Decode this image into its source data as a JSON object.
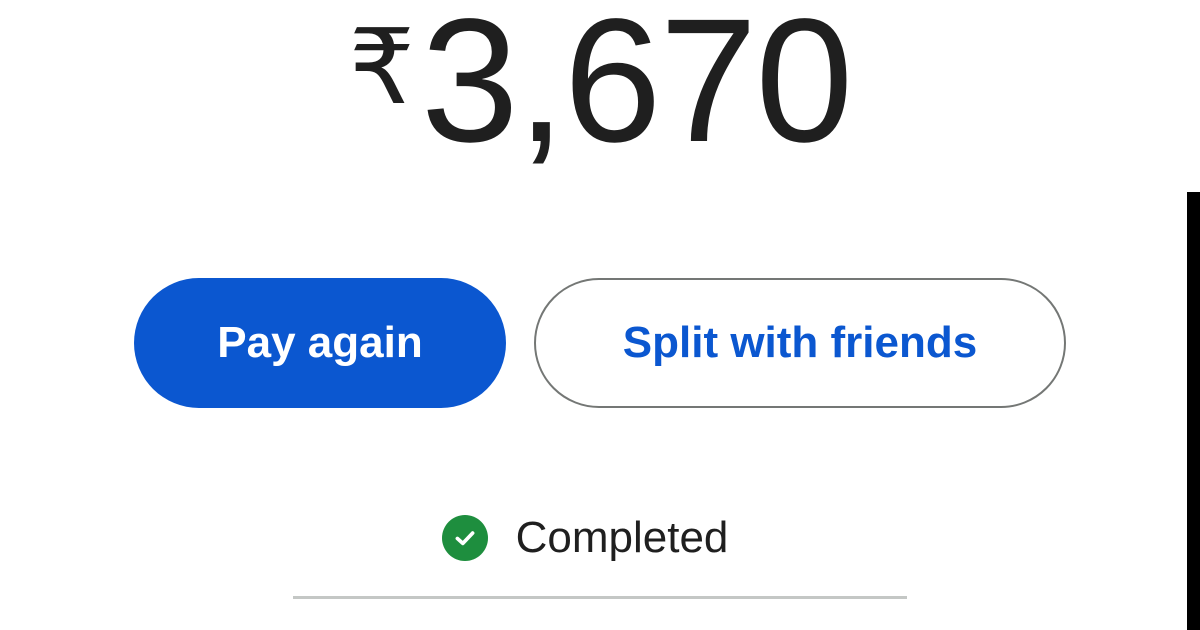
{
  "payment": {
    "currency_symbol": "₹",
    "amount": "3,670"
  },
  "actions": {
    "pay_again_label": "Pay again",
    "split_label": "Split with friends"
  },
  "status": {
    "icon": "check-circle-icon",
    "label": "Completed",
    "color": "#1e8e3e"
  },
  "colors": {
    "primary": "#0b57d0",
    "text": "#1f1f1f",
    "outline": "#747775",
    "divider": "#c4c7c5"
  }
}
